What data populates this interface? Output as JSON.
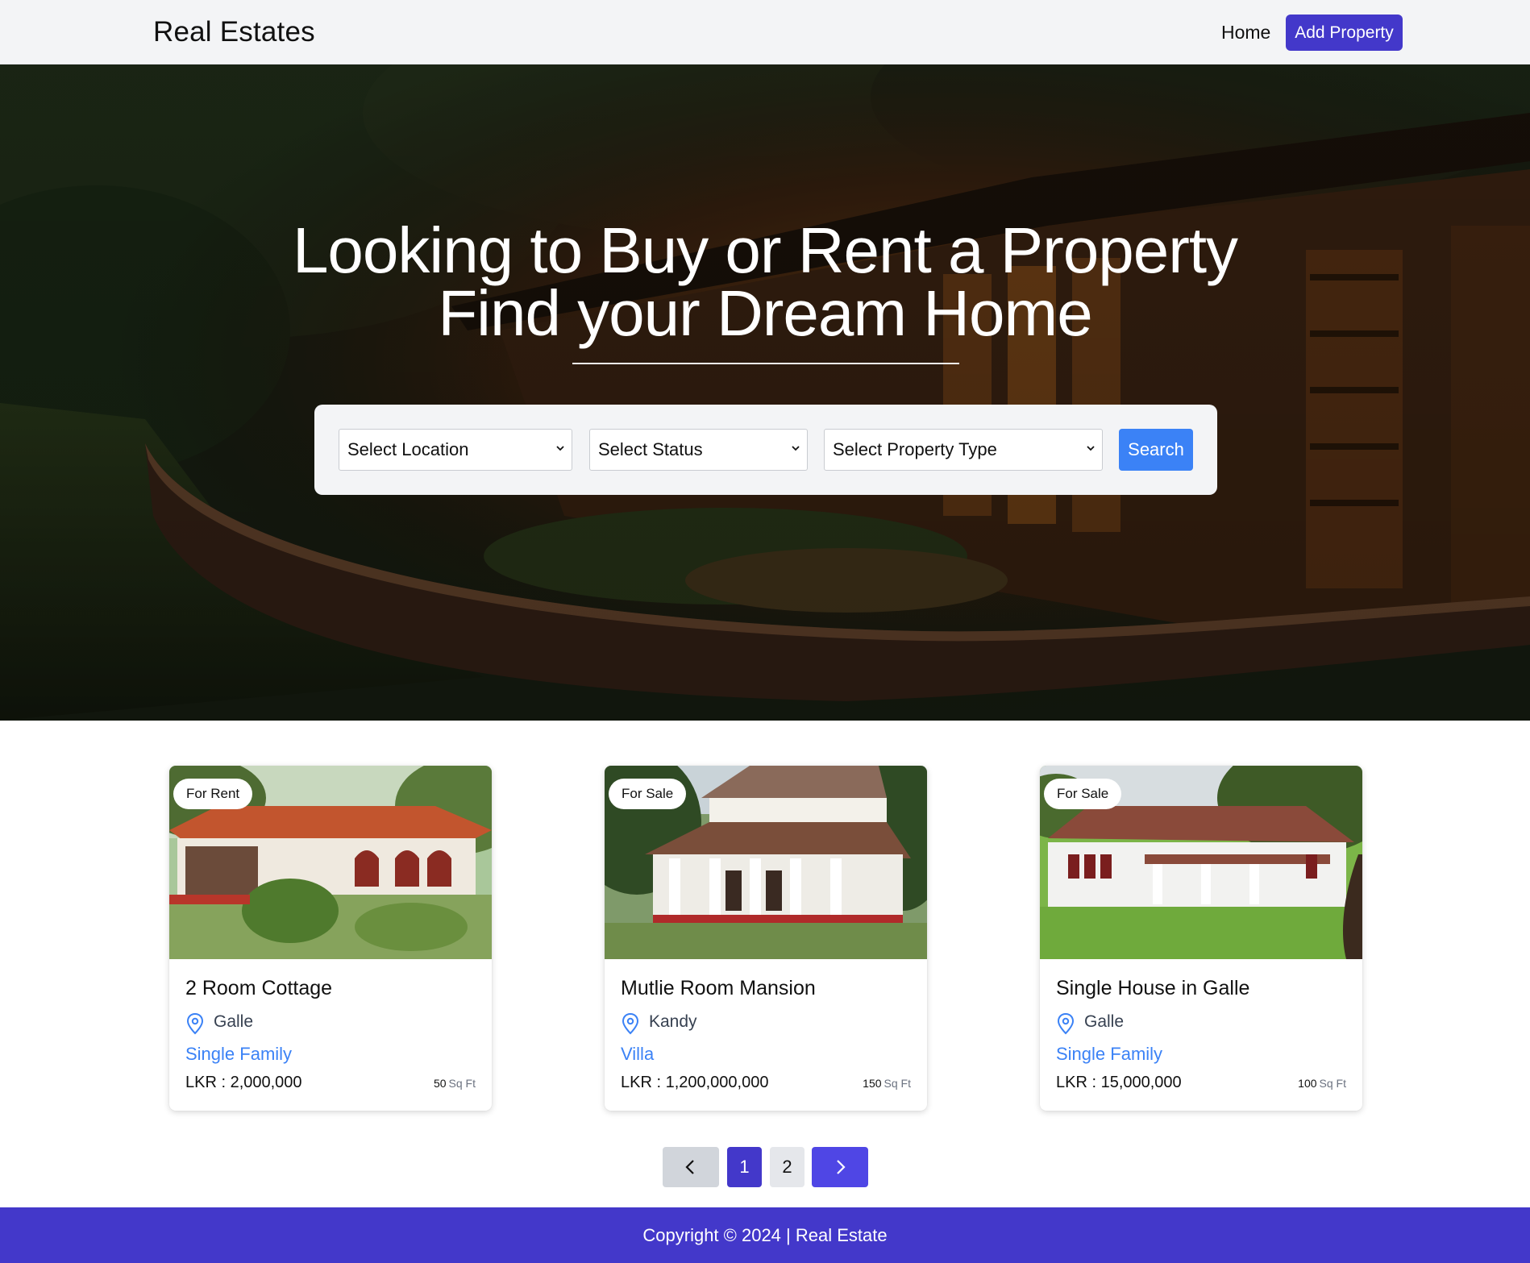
{
  "header": {
    "brand": "Real Estates",
    "nav_home": "Home",
    "nav_add": "Add Property"
  },
  "hero": {
    "title_line1": "Looking to Buy or Rent a Property",
    "title_line2": "Find your Dream Home"
  },
  "search": {
    "location_placeholder": "Select Location",
    "status_placeholder": "Select Status",
    "type_placeholder": "Select Property Type",
    "button_label": "Search"
  },
  "listings": [
    {
      "badge": "For Rent",
      "title": "2 Room Cottage",
      "location": "Galle",
      "type": "Single Family",
      "price": "LKR : 2,000,000",
      "area_value": "50",
      "area_unit": "Sq Ft"
    },
    {
      "badge": "For Sale",
      "title": "Mutlie Room Mansion",
      "location": "Kandy",
      "type": "Villa",
      "price": "LKR : 1,200,000,000",
      "area_value": "150",
      "area_unit": "Sq Ft"
    },
    {
      "badge": "For Sale",
      "title": "Single House in Galle",
      "location": "Galle",
      "type": "Single Family",
      "price": "LKR : 15,000,000",
      "area_value": "100",
      "area_unit": "Sq Ft"
    }
  ],
  "pagination": {
    "pages": [
      "1",
      "2"
    ],
    "current": "1",
    "prev_icon": "chevron-left-icon",
    "next_icon": "chevron-right-icon"
  },
  "footer": {
    "text": "Copyright © 2024 | Real Estate"
  },
  "colors": {
    "primary": "#4338ca",
    "accent_blue": "#3b82f6",
    "header_bg": "#f3f4f6"
  }
}
